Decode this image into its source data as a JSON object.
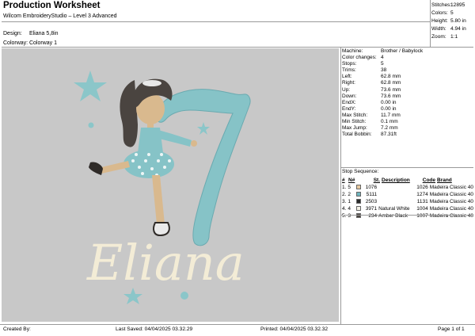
{
  "header": {
    "title": "Production Worksheet",
    "subtitle": "Wilcom EmbroideryStudio – Level 3 Advanced",
    "design_label": "Design:",
    "design_value": "Eliana 5,8in",
    "colorway_label": "Colorway:",
    "colorway_value": "Colorway 1"
  },
  "stats": [
    {
      "label": "Stitches:",
      "value": "12895"
    },
    {
      "label": "Colors:",
      "value": "5"
    },
    {
      "label": "Height:",
      "value": "5.80 in"
    },
    {
      "label": "Width:",
      "value": "4.94 in"
    },
    {
      "label": "Zoom:",
      "value": "1:1"
    }
  ],
  "preview": {
    "text": "Eliana",
    "number": "7",
    "colors": {
      "background": "#c8c8c8",
      "teal": "#86c3c7",
      "hair": "#4a4440",
      "skin": "#d9b98e",
      "cream": "#f3ecd6"
    }
  },
  "specs": [
    {
      "label": "Machine:",
      "value": "Brother / Babylock"
    },
    {
      "label": "Color changes:",
      "value": "4"
    },
    {
      "label": "Stops:",
      "value": "5"
    },
    {
      "label": "Trims:",
      "value": "38"
    },
    {
      "label": "Left:",
      "value": "62.8 mm"
    },
    {
      "label": "Right:",
      "value": "62.8 mm"
    },
    {
      "label": "Up:",
      "value": "73.6 mm"
    },
    {
      "label": "Down:",
      "value": "73.6 mm"
    },
    {
      "label": "EndX:",
      "value": "0.00 in"
    },
    {
      "label": "EndY:",
      "value": "0.00 in"
    },
    {
      "label": "Max Stitch:",
      "value": "11.7 mm"
    },
    {
      "label": "Min Stitch:",
      "value": "0.1 mm"
    },
    {
      "label": "Max Jump:",
      "value": "7.2 mm"
    },
    {
      "label": "Total Bobbin:",
      "value": "87.31ft"
    }
  ],
  "sequence": {
    "title": "Stop Sequence:",
    "headers": [
      "#",
      "N#",
      "",
      "St.",
      "Description",
      "Code",
      "Brand"
    ],
    "rows": [
      {
        "idx": "1.",
        "n": "5",
        "color": "#e6c9a0",
        "st": "1076",
        "desc": "",
        "code": "1026",
        "brand": "Madeira Classic 40"
      },
      {
        "idx": "2.",
        "n": "2",
        "color": "#6fb4bd",
        "st": "5111",
        "desc": "",
        "code": "1274",
        "brand": "Madeira Classic 40"
      },
      {
        "idx": "3.",
        "n": "1",
        "color": "#2a2a2a",
        "st": "2503",
        "desc": "",
        "code": "1131",
        "brand": "Madeira Classic 40"
      },
      {
        "idx": "4.",
        "n": "4",
        "color": "#f5f2e6",
        "st": "3971",
        "desc": "Natural White",
        "code": "1004",
        "brand": "Madeira Classic 40"
      },
      {
        "idx": "5.",
        "n": "3",
        "color": "#4b4540",
        "st": "234",
        "desc": "Amber Black",
        "code": "1007",
        "brand": "Madeira Classic 40"
      }
    ]
  },
  "footer": {
    "created_by": "Created By:",
    "last_saved": "Last Saved: 04/04/2025 03.32.29",
    "printed": "Printed: 04/04/2025 03.32.32",
    "page": "Page 1 of 1"
  }
}
